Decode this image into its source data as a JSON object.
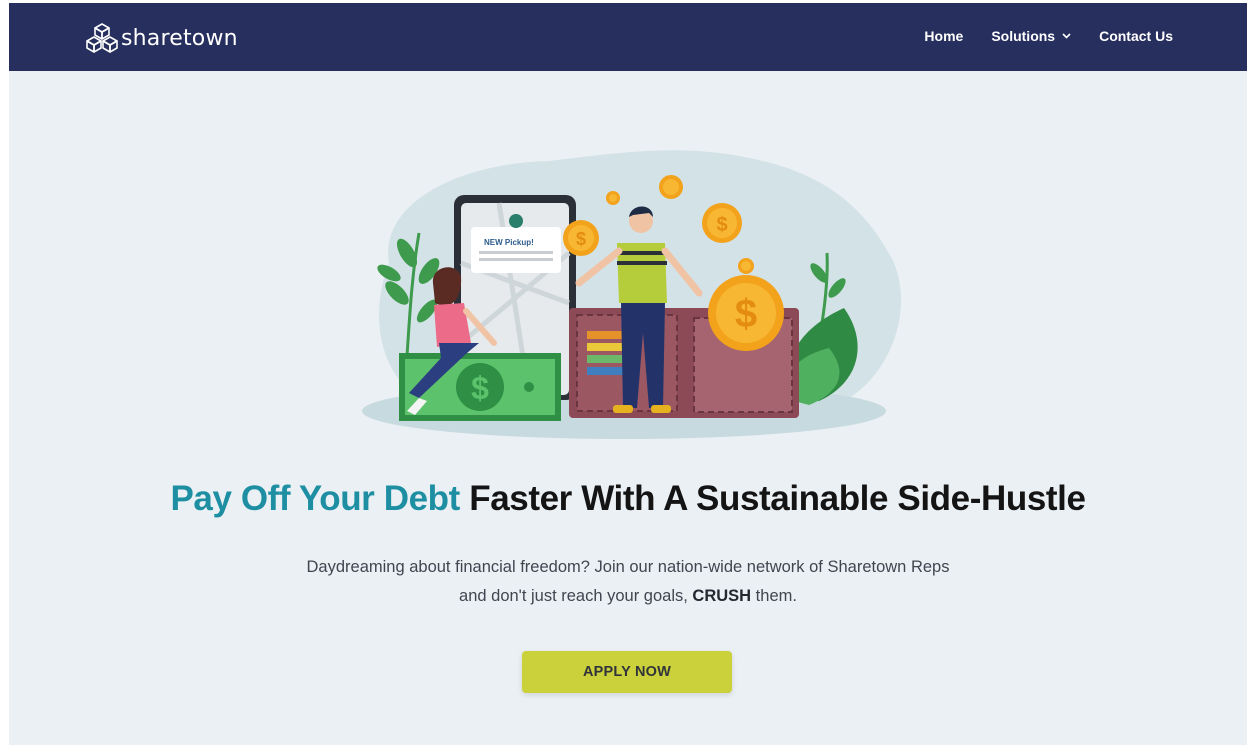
{
  "brand": {
    "name": "sharetown",
    "icon": "box-stack-logo-icon"
  },
  "nav": {
    "items": [
      {
        "label": "Home"
      },
      {
        "label": "Solutions",
        "icon": "chevron-down-icon"
      },
      {
        "label": "Contact Us"
      }
    ]
  },
  "hero": {
    "illustration": {
      "card_label": "NEW Pickup!",
      "description_icons": [
        "phone-map-icon",
        "wallet-icon",
        "dollar-bill-icon",
        "coin-icon"
      ]
    },
    "headline_accent": "Pay Off Your Debt",
    "headline_rest": " Faster With A Sustainable Side-Hustle",
    "subtitle_line1": "Daydreaming about financial freedom? Join our nation-wide network of Sharetown Reps",
    "subtitle_line2_before": "and don't just reach your goals, ",
    "subtitle_line2_strong": "CRUSH",
    "subtitle_line2_after": " them.",
    "cta_label": "APPLY NOW"
  },
  "colors": {
    "navbar": "#272f5e",
    "page_bg": "#ebf0f4",
    "accent_teal": "#1e8fa3",
    "cta": "#cbd13b"
  }
}
